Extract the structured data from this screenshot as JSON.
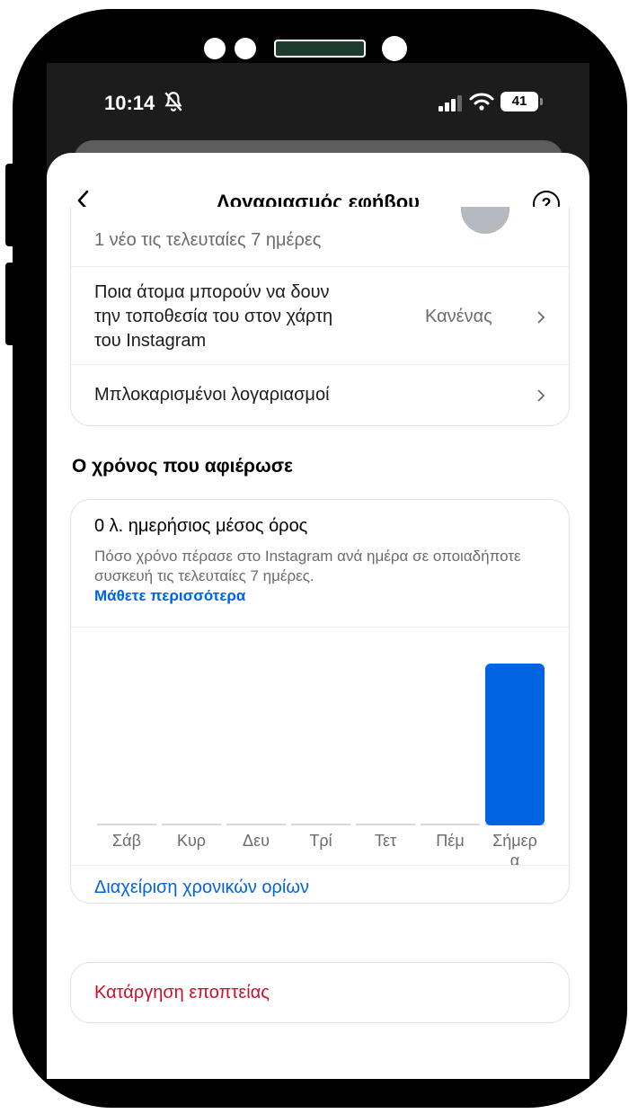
{
  "status_bar": {
    "time": "10:14",
    "battery": "41"
  },
  "nav": {
    "title": "Λογαριασμός εφήβου",
    "help_glyph": "?"
  },
  "settings": {
    "partial_row_text": "1 νέο τις τελευταίες 7 ημέρες",
    "location_row": {
      "label_lines": [
        "Ποια άτομα μπορούν να δουν",
        "την τοποθεσία του στον χάρτη",
        "του Instagram"
      ],
      "value": "Κανένας"
    },
    "blocked_row": {
      "label": "Μπλοκαρισμένοι λογαριασμοί"
    }
  },
  "time_section": {
    "title": "Ο χρόνος που αφιέρωσε",
    "average": "0 λ. ημερήσιος μέσος όρος",
    "description": "Πόσο χρόνο πέρασε στο Instagram ανά ημέρα σε οποιαδήποτε συσκευή τις τελευταίες 7 ημέρες.",
    "learn_more": "Μάθετε περισσότερα",
    "manage_limits": "Διαχείριση χρονικών ορίων"
  },
  "chart_data": {
    "type": "bar",
    "categories": [
      "Σάβ",
      "Κυρ",
      "Δευ",
      "Τρί",
      "Τετ",
      "Πέμ",
      "Σήμερα"
    ],
    "category_display": [
      "Σάβ",
      "Κυρ",
      "Δευ",
      "Τρί",
      "Τετ",
      "Πέμ",
      "Σήμερ\nα"
    ],
    "values": [
      0,
      0,
      0,
      0,
      0,
      0,
      1
    ],
    "ylim": [
      0,
      1
    ],
    "grid": false,
    "bar_color": "#0064e0"
  },
  "remove_supervision": "Κατάργηση εποπτείας",
  "colors": {
    "accent": "#0064e0",
    "danger": "#c8102e",
    "status_bg": "#1c1c1d"
  }
}
